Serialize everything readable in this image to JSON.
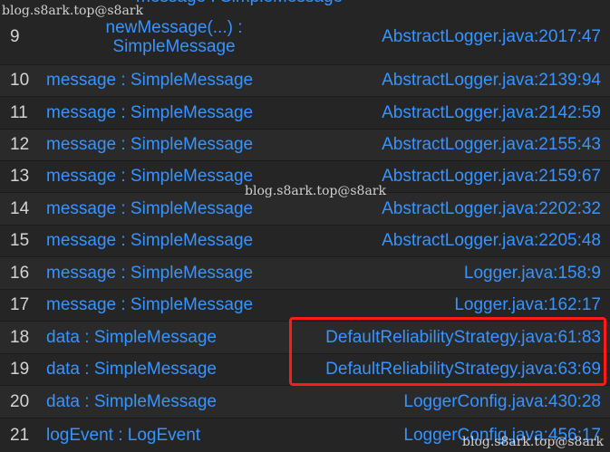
{
  "top_partial_text": "message : SimpleMessage",
  "frames": [
    {
      "num": "9",
      "name_line1": "newMessage(...) :",
      "name_line2": "SimpleMessage",
      "location": "AbstractLogger.java:2017:47"
    },
    {
      "num": "10",
      "name": "message : SimpleMessage",
      "location": "AbstractLogger.java:2139:94"
    },
    {
      "num": "11",
      "name": "message : SimpleMessage",
      "location": "AbstractLogger.java:2142:59"
    },
    {
      "num": "12",
      "name": "message : SimpleMessage",
      "location": "AbstractLogger.java:2155:43"
    },
    {
      "num": "13",
      "name": "message : SimpleMessage",
      "location": "AbstractLogger.java:2159:67"
    },
    {
      "num": "14",
      "name": "message : SimpleMessage",
      "location": "AbstractLogger.java:2202:32"
    },
    {
      "num": "15",
      "name": "message : SimpleMessage",
      "location": "AbstractLogger.java:2205:48"
    },
    {
      "num": "16",
      "name": "message : SimpleMessage",
      "location": "Logger.java:158:9"
    },
    {
      "num": "17",
      "name": "message : SimpleMessage",
      "location": "Logger.java:162:17"
    },
    {
      "num": "18",
      "name": "data : SimpleMessage",
      "location": "DefaultReliabilityStrategy.java:61:83"
    },
    {
      "num": "19",
      "name": "data : SimpleMessage",
      "location": "DefaultReliabilityStrategy.java:63:69"
    },
    {
      "num": "20",
      "name": "data : SimpleMessage",
      "location": "LoggerConfig.java:430:28"
    },
    {
      "num": "21",
      "name": "logEvent : LogEvent",
      "location": "LoggerConfig.java:456:17"
    }
  ],
  "watermark": "blog.s8ark.top@s8ark",
  "colors": {
    "background": "#1e1e1e",
    "link": "#3794ff",
    "number": "#d4d4d4",
    "highlight": "#ff1a1a"
  }
}
